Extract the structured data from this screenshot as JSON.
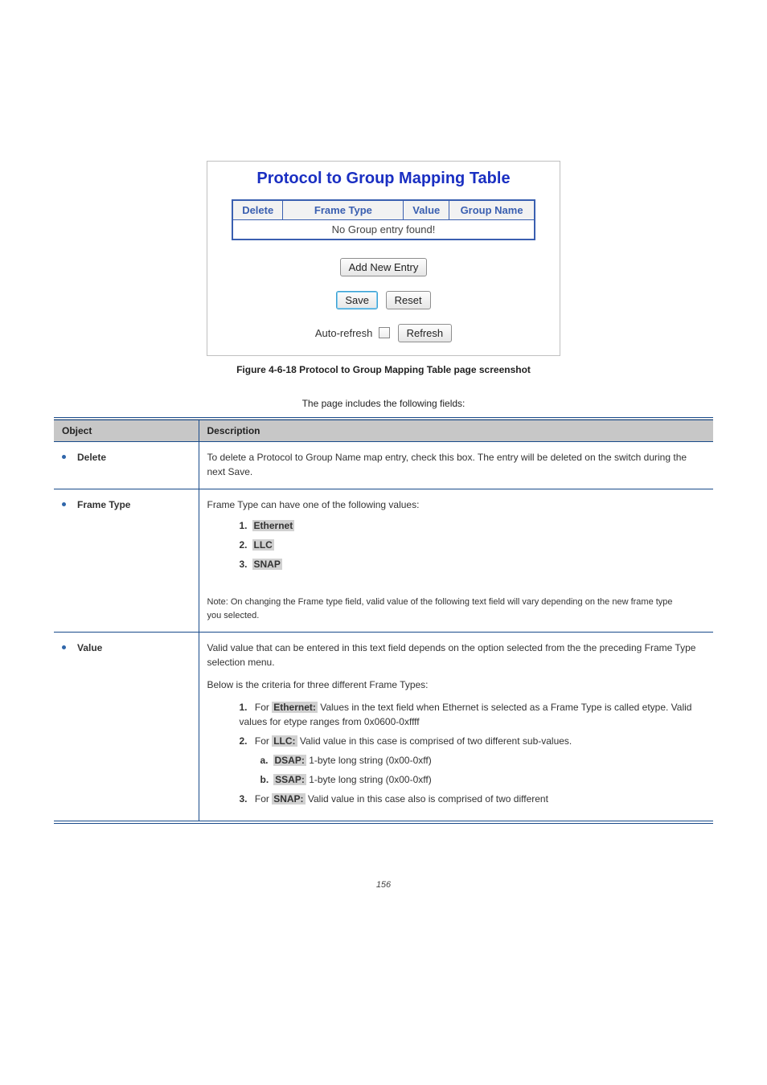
{
  "panel": {
    "title": "Protocol to Group Mapping Table",
    "headers": {
      "delete": "Delete",
      "frame": "Frame Type",
      "value": "Value",
      "group": "Group Name"
    },
    "emptyRow": "No Group entry found!",
    "btn_add": "Add New Entry",
    "btn_save": "Save",
    "btn_reset": "Reset",
    "auto_label": "Auto-refresh",
    "btn_refresh": "Refresh"
  },
  "figCaption": "Figure 4-6-18 Protocol to Group Mapping Table page screenshot",
  "intro": "The page includes the following fields:",
  "descHeaders": {
    "obj": "Object",
    "desc": "Description"
  },
  "rows": {
    "r1": {
      "obj": "Delete",
      "desc": "To delete a Protocol to Group Name map entry, check this box. The entry will be deleted on the switch during the next Save."
    },
    "r2": {
      "obj": "Frame Type",
      "lead": "Frame Type can have one of the following values:",
      "i1n": "1.",
      "i1l": "Ethernet",
      "i2n": "2.",
      "i2l": "LLC",
      "i3n": "3.",
      "i3l": "SNAP",
      "note": "Note: On changing the Frame type field, valid value of the following text field will vary depending on the new frame type you selected."
    },
    "r3": {
      "obj": "Value",
      "lead1": "Valid value that can be entered in this text field depends on the option selected from the the preceding Frame Type selection menu.",
      "lead2": "Below is the criteria for three different Frame Types:",
      "i1n": "1.",
      "i1a": "For ",
      "i1l": "Ethernet:",
      "i1b": " Values in the text field when Ethernet is selected as a Frame Type is called etype. Valid values for etype ranges from 0x0600-0xffff",
      "i2n": "2.",
      "i2a": "For ",
      "i2l": "LLC:",
      "i2b": " Valid value in this case is comprised of two different sub-values.",
      "sa": "a.",
      "sal": "DSAP:",
      "sab": " 1-byte long string (0x00-0xff)",
      "sb": "b.",
      "sbl": "SSAP:",
      "sbb": " 1-byte long string (0x00-0xff)",
      "i3n": "3.",
      "i3a": "For ",
      "i3l": "SNAP:",
      "i3b": " Valid value in this case also is comprised of two different"
    }
  },
  "footer": "156"
}
